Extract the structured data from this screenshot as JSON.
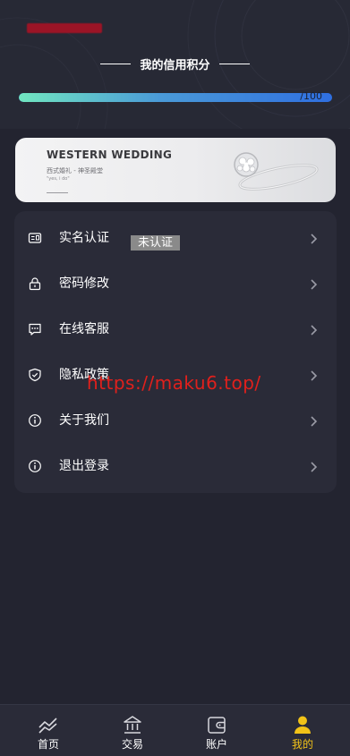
{
  "header": {
    "credit_title": "我的信用积分",
    "progress_text": "/100",
    "progress_fraction": 1.0
  },
  "banner": {
    "title": "WESTERN WEDDING",
    "subtitle": "西式婚礼 - 神圣殿堂",
    "quote": "\"yes, i do\""
  },
  "menu": {
    "items": [
      {
        "label": "实名认证",
        "badge": "未认证",
        "icon": "id-card-icon"
      },
      {
        "label": "密码修改",
        "icon": "lock-icon"
      },
      {
        "label": "在线客服",
        "icon": "chat-icon"
      },
      {
        "label": "隐私政策",
        "icon": "shield-icon"
      },
      {
        "label": "关于我们",
        "icon": "info-icon"
      },
      {
        "label": "退出登录",
        "icon": "info-icon"
      }
    ]
  },
  "watermark": "https://maku6.top/",
  "tabbar": {
    "active_color": "#f2c318",
    "tabs": [
      {
        "label": "首页",
        "icon": "chart-line-icon"
      },
      {
        "label": "交易",
        "icon": "bank-icon"
      },
      {
        "label": "账户",
        "icon": "wallet-icon"
      },
      {
        "label": "我的",
        "icon": "user-icon"
      }
    ]
  }
}
